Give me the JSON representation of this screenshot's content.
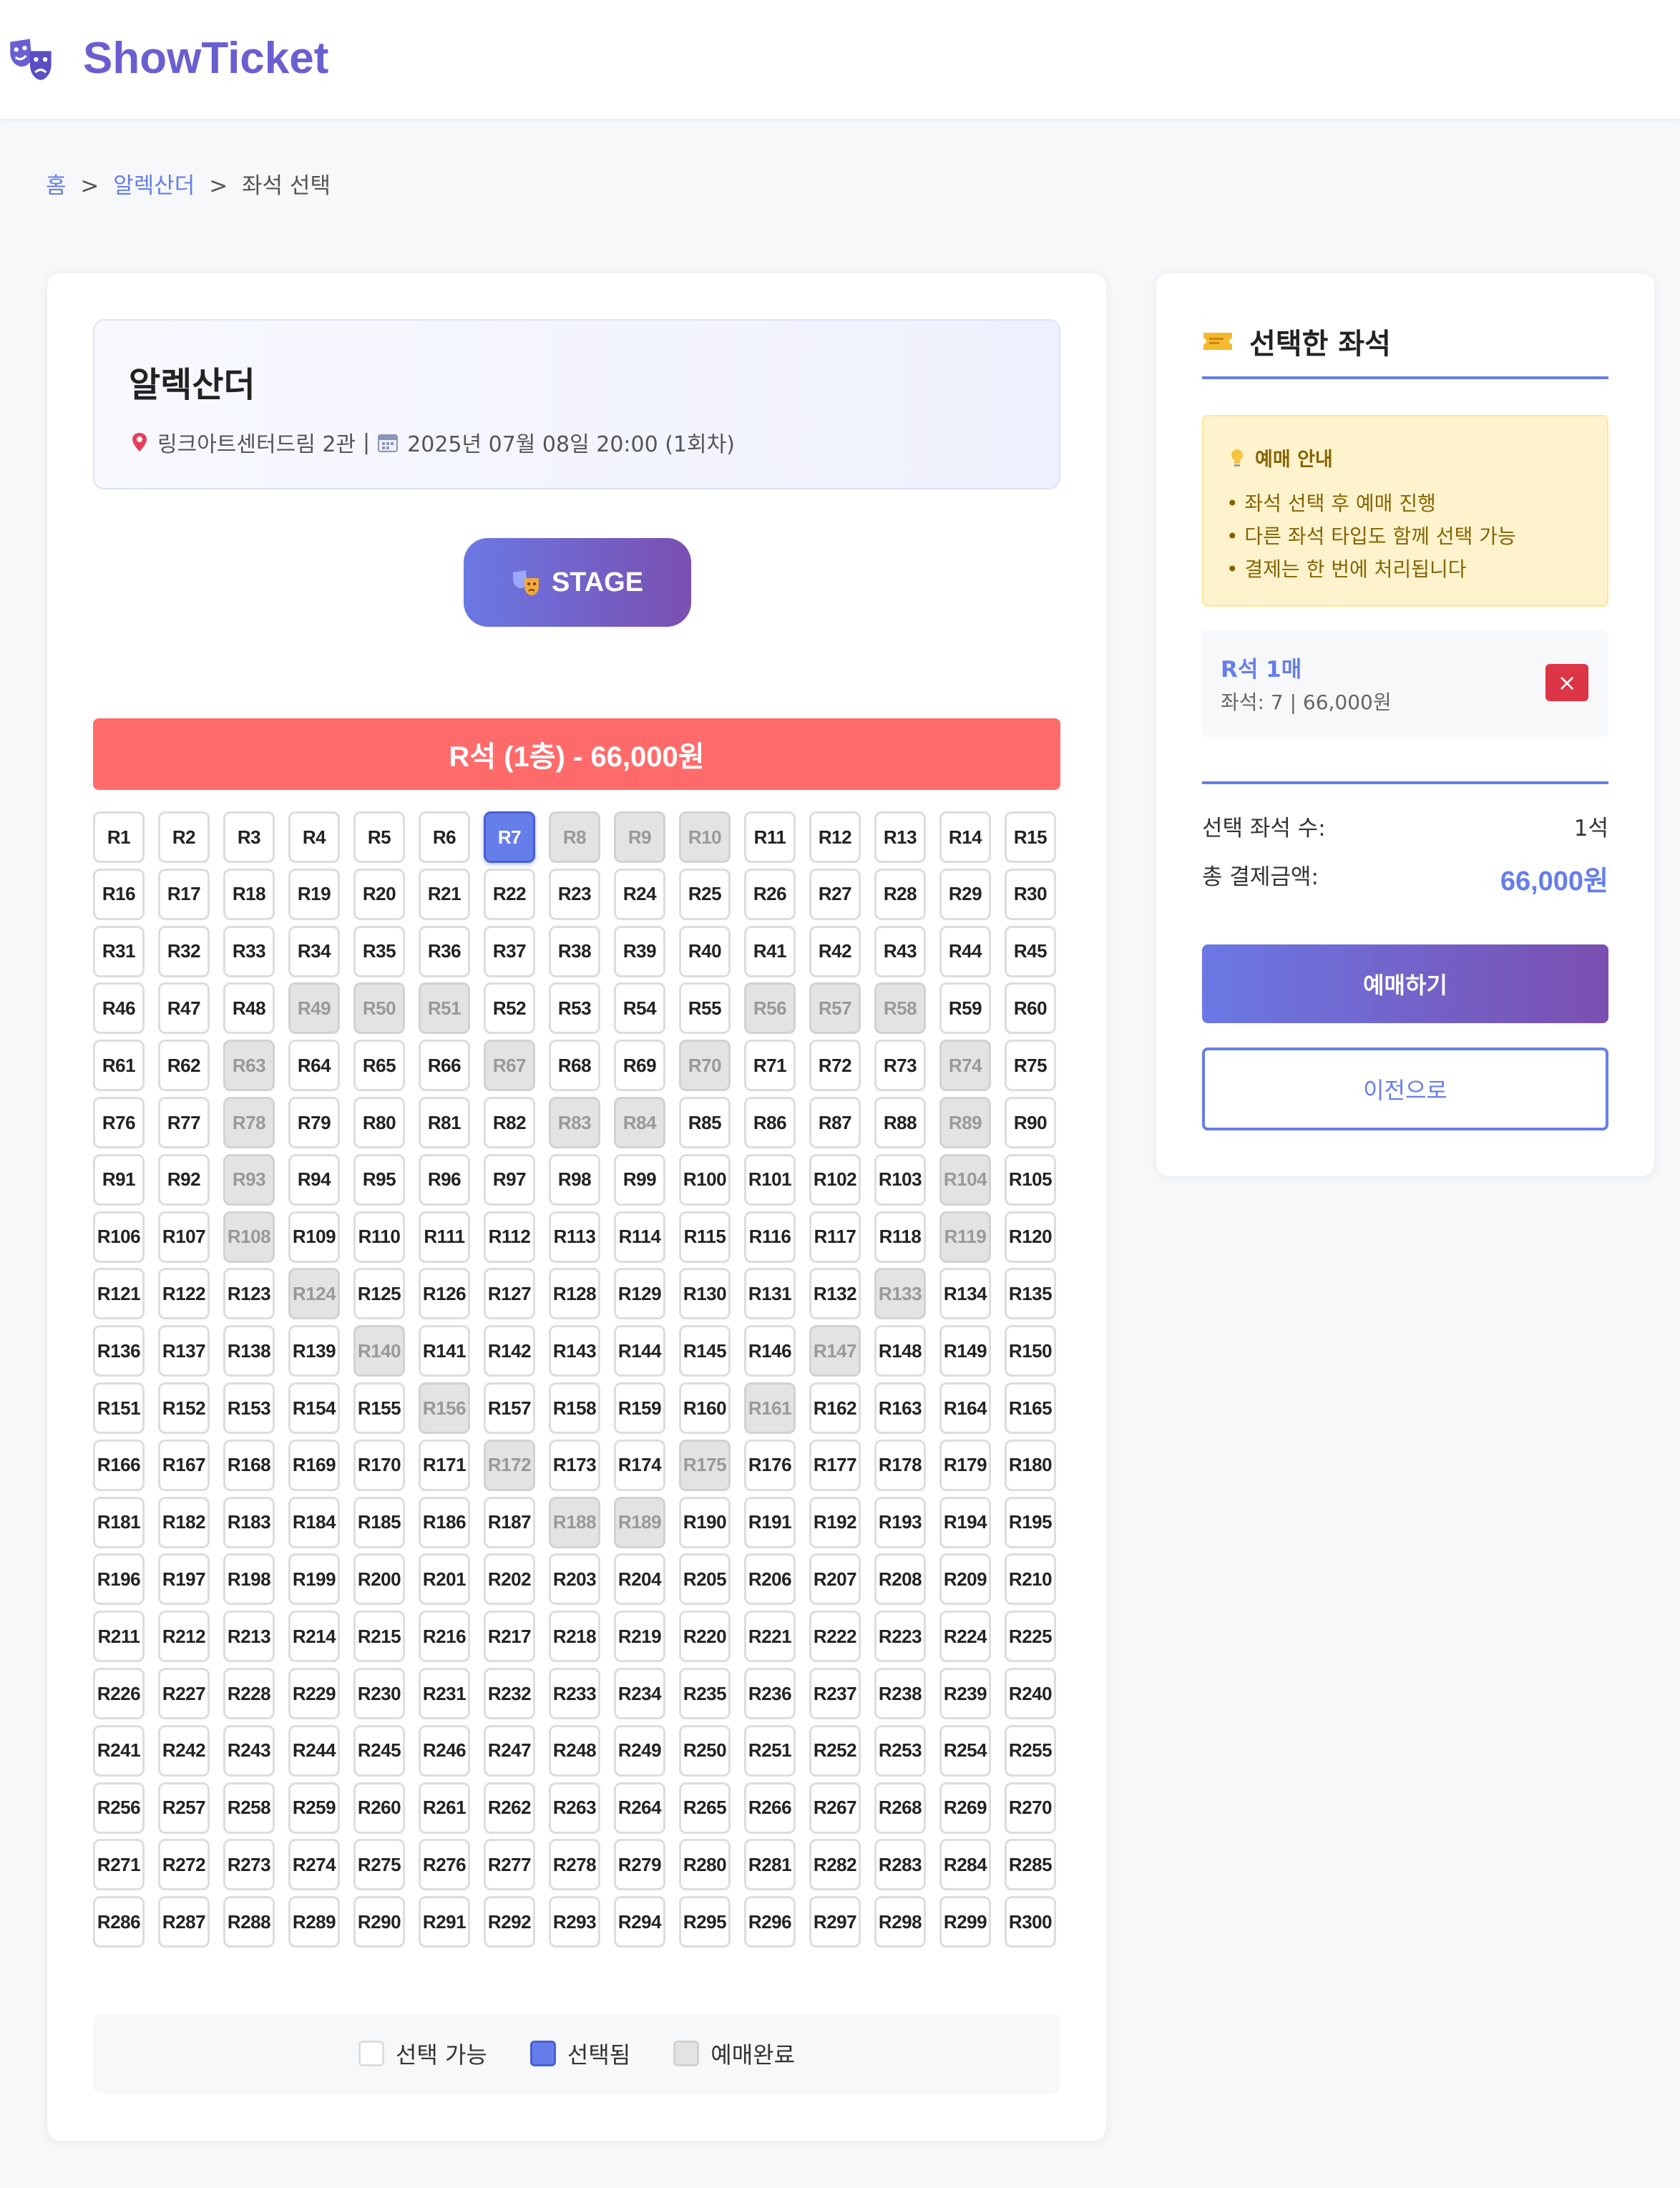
{
  "header": {
    "logo_text": "ShowTicket",
    "logo_icon": "theater-masks-icon"
  },
  "breadcrumb": {
    "home": "홈",
    "show": "알렉산더",
    "current": "좌석 선택",
    "separator": ">"
  },
  "show": {
    "title": "알렉산더",
    "venue": "링크아트센터드림 2관",
    "divider": "|",
    "datetime": "2025년 07월 08일 20:00 (1회차)"
  },
  "stage": {
    "label": "STAGE"
  },
  "section": {
    "label": "R석 (1층) - 66,000원",
    "color": "#ff6b6b"
  },
  "seats": {
    "prefix": "R",
    "total": 300,
    "per_row": 15,
    "selected": [
      7
    ],
    "booked": [
      8,
      9,
      10,
      49,
      50,
      51,
      56,
      57,
      58,
      63,
      67,
      70,
      74,
      78,
      83,
      84,
      89,
      93,
      104,
      108,
      119,
      124,
      133,
      140,
      147,
      156,
      161,
      172,
      175,
      188,
      189
    ]
  },
  "legend": {
    "available": "선택 가능",
    "selected": "선택됨",
    "booked": "예매완료"
  },
  "sidebar": {
    "title": "선택한 좌석",
    "notice_title": "예매 안내",
    "notice_items": [
      "• 좌석 선택 후 예매 진행",
      "• 다른 좌석 타입도 함께 선택 가능",
      "• 결제는 한 번에 처리됩니다"
    ],
    "selected_item": {
      "name": "R석 1매",
      "detail": "좌석: 7 | 66,000원",
      "remove": "×"
    },
    "count_label": "선택 좌석 수:",
    "count_value": "1석",
    "total_label": "총 결제금액:",
    "total_value": "66,000원",
    "book_button": "예매하기",
    "back_button": "이전으로"
  },
  "colors": {
    "accent": "#667eea",
    "accent_dark": "#764ba2",
    "section": "#ff6b6b",
    "remove": "#dc3545"
  }
}
